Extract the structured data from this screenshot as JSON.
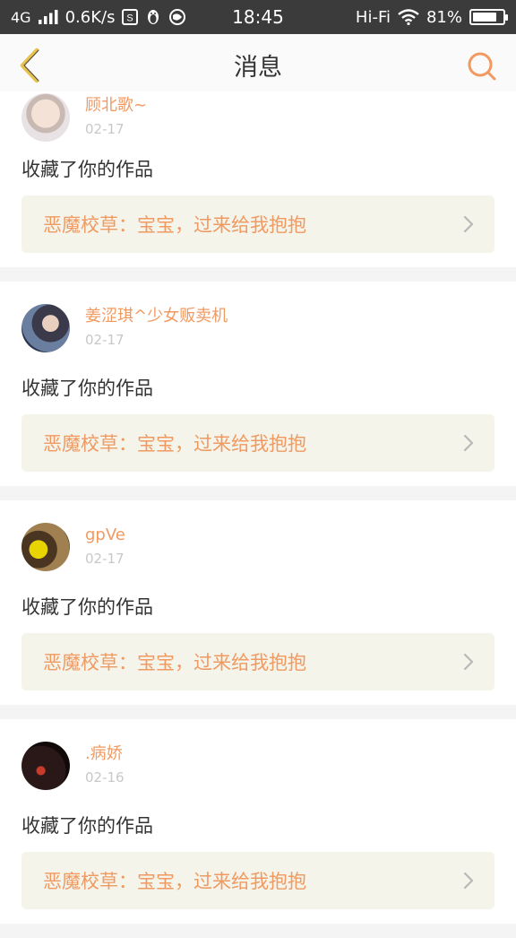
{
  "status_bar": {
    "network": "4G",
    "speed": "0.6K/s",
    "time": "18:45",
    "hifi": "Hi-Fi",
    "battery": "81%",
    "battery_level": 0.81
  },
  "header": {
    "title": "消息"
  },
  "notifications": [
    {
      "username": "顾北歌~",
      "date": "02-17",
      "action": "收藏了你的作品",
      "work_title": "恶魔校草：宝宝，过来给我抱抱"
    },
    {
      "username": "姜涩琪^少女贩卖机",
      "date": "02-17",
      "action": "收藏了你的作品",
      "work_title": "恶魔校草：宝宝，过来给我抱抱"
    },
    {
      "username": "gpVe",
      "date": "02-17",
      "action": "收藏了你的作品",
      "work_title": "恶魔校草：宝宝，过来给我抱抱"
    },
    {
      "username": ".病娇",
      "date": "02-16",
      "action": "收藏了你的作品",
      "work_title": "恶魔校草：宝宝，过来给我抱抱"
    }
  ],
  "colors": {
    "accent": "#f09a62",
    "back_arrow": "#e8c24a",
    "card_bg": "#f4f4ea"
  },
  "icons": {
    "back": "back-arrow-icon",
    "search": "search-icon",
    "chevron": "chevron-right-icon"
  }
}
